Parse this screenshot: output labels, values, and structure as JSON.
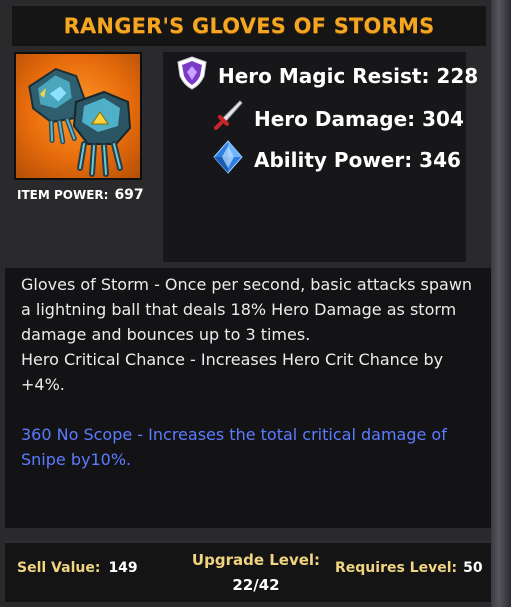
{
  "title": "RANGER'S GLOVES OF STORMS",
  "item": {
    "image_icon": "storm-gloves-icon",
    "power_label": "ITEM POWER:",
    "power_value": "697"
  },
  "stats": [
    {
      "icon": "shield-icon",
      "label": "Hero Magic Resist: 228"
    },
    {
      "icon": "sword-icon",
      "label": "Hero Damage: 304"
    },
    {
      "icon": "diamond-icon",
      "label": "Ability Power: 346"
    }
  ],
  "description": {
    "lines": [
      "Gloves of Storm - Once per second, basic attacks spawn a lightning ball that deals 18% Hero Damage as storm damage and bounces up to 3 times.",
      "Hero Critical Chance - Increases Hero Crit Chance by +4%."
    ],
    "talent": "360 No Scope - Increases the total critical damage of Snipe by10%."
  },
  "footer": {
    "sell_label": "Sell Value:",
    "sell_value": "149",
    "upgrade_label": "Upgrade Level:",
    "upgrade_value": "22/42",
    "requires_label": "Requires Level:",
    "requires_value": "50"
  },
  "colors": {
    "title": "#f5a623",
    "talent": "#5b7cff",
    "footer_label": "#f0d480"
  }
}
